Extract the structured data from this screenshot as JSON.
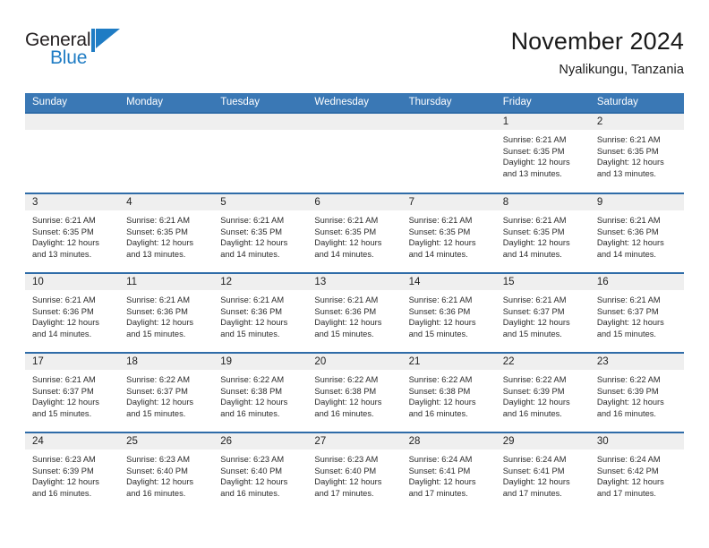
{
  "brand": {
    "name_part1": "General",
    "name_part2": "Blue",
    "mark_icon": "triangle-flag-icon",
    "mark_color": "#1f7cc4"
  },
  "header": {
    "title": "November 2024",
    "subtitle": "Nyalikungu, Tanzania"
  },
  "theme": {
    "header_blue": "#3a78b5",
    "row_border_blue": "#2f6ca8",
    "day_strip_gray": "#efefef",
    "brand_blue": "#1f7cc4"
  },
  "calendar": {
    "weekday_headers": [
      "Sunday",
      "Monday",
      "Tuesday",
      "Wednesday",
      "Thursday",
      "Friday",
      "Saturday"
    ],
    "weeks": [
      [
        {
          "day": "",
          "lines": []
        },
        {
          "day": "",
          "lines": []
        },
        {
          "day": "",
          "lines": []
        },
        {
          "day": "",
          "lines": []
        },
        {
          "day": "",
          "lines": []
        },
        {
          "day": "1",
          "lines": [
            "Sunrise: 6:21 AM",
            "Sunset: 6:35 PM",
            "Daylight: 12 hours",
            "and 13 minutes."
          ]
        },
        {
          "day": "2",
          "lines": [
            "Sunrise: 6:21 AM",
            "Sunset: 6:35 PM",
            "Daylight: 12 hours",
            "and 13 minutes."
          ]
        }
      ],
      [
        {
          "day": "3",
          "lines": [
            "Sunrise: 6:21 AM",
            "Sunset: 6:35 PM",
            "Daylight: 12 hours",
            "and 13 minutes."
          ]
        },
        {
          "day": "4",
          "lines": [
            "Sunrise: 6:21 AM",
            "Sunset: 6:35 PM",
            "Daylight: 12 hours",
            "and 13 minutes."
          ]
        },
        {
          "day": "5",
          "lines": [
            "Sunrise: 6:21 AM",
            "Sunset: 6:35 PM",
            "Daylight: 12 hours",
            "and 14 minutes."
          ]
        },
        {
          "day": "6",
          "lines": [
            "Sunrise: 6:21 AM",
            "Sunset: 6:35 PM",
            "Daylight: 12 hours",
            "and 14 minutes."
          ]
        },
        {
          "day": "7",
          "lines": [
            "Sunrise: 6:21 AM",
            "Sunset: 6:35 PM",
            "Daylight: 12 hours",
            "and 14 minutes."
          ]
        },
        {
          "day": "8",
          "lines": [
            "Sunrise: 6:21 AM",
            "Sunset: 6:35 PM",
            "Daylight: 12 hours",
            "and 14 minutes."
          ]
        },
        {
          "day": "9",
          "lines": [
            "Sunrise: 6:21 AM",
            "Sunset: 6:36 PM",
            "Daylight: 12 hours",
            "and 14 minutes."
          ]
        }
      ],
      [
        {
          "day": "10",
          "lines": [
            "Sunrise: 6:21 AM",
            "Sunset: 6:36 PM",
            "Daylight: 12 hours",
            "and 14 minutes."
          ]
        },
        {
          "day": "11",
          "lines": [
            "Sunrise: 6:21 AM",
            "Sunset: 6:36 PM",
            "Daylight: 12 hours",
            "and 15 minutes."
          ]
        },
        {
          "day": "12",
          "lines": [
            "Sunrise: 6:21 AM",
            "Sunset: 6:36 PM",
            "Daylight: 12 hours",
            "and 15 minutes."
          ]
        },
        {
          "day": "13",
          "lines": [
            "Sunrise: 6:21 AM",
            "Sunset: 6:36 PM",
            "Daylight: 12 hours",
            "and 15 minutes."
          ]
        },
        {
          "day": "14",
          "lines": [
            "Sunrise: 6:21 AM",
            "Sunset: 6:36 PM",
            "Daylight: 12 hours",
            "and 15 minutes."
          ]
        },
        {
          "day": "15",
          "lines": [
            "Sunrise: 6:21 AM",
            "Sunset: 6:37 PM",
            "Daylight: 12 hours",
            "and 15 minutes."
          ]
        },
        {
          "day": "16",
          "lines": [
            "Sunrise: 6:21 AM",
            "Sunset: 6:37 PM",
            "Daylight: 12 hours",
            "and 15 minutes."
          ]
        }
      ],
      [
        {
          "day": "17",
          "lines": [
            "Sunrise: 6:21 AM",
            "Sunset: 6:37 PM",
            "Daylight: 12 hours",
            "and 15 minutes."
          ]
        },
        {
          "day": "18",
          "lines": [
            "Sunrise: 6:22 AM",
            "Sunset: 6:37 PM",
            "Daylight: 12 hours",
            "and 15 minutes."
          ]
        },
        {
          "day": "19",
          "lines": [
            "Sunrise: 6:22 AM",
            "Sunset: 6:38 PM",
            "Daylight: 12 hours",
            "and 16 minutes."
          ]
        },
        {
          "day": "20",
          "lines": [
            "Sunrise: 6:22 AM",
            "Sunset: 6:38 PM",
            "Daylight: 12 hours",
            "and 16 minutes."
          ]
        },
        {
          "day": "21",
          "lines": [
            "Sunrise: 6:22 AM",
            "Sunset: 6:38 PM",
            "Daylight: 12 hours",
            "and 16 minutes."
          ]
        },
        {
          "day": "22",
          "lines": [
            "Sunrise: 6:22 AM",
            "Sunset: 6:39 PM",
            "Daylight: 12 hours",
            "and 16 minutes."
          ]
        },
        {
          "day": "23",
          "lines": [
            "Sunrise: 6:22 AM",
            "Sunset: 6:39 PM",
            "Daylight: 12 hours",
            "and 16 minutes."
          ]
        }
      ],
      [
        {
          "day": "24",
          "lines": [
            "Sunrise: 6:23 AM",
            "Sunset: 6:39 PM",
            "Daylight: 12 hours",
            "and 16 minutes."
          ]
        },
        {
          "day": "25",
          "lines": [
            "Sunrise: 6:23 AM",
            "Sunset: 6:40 PM",
            "Daylight: 12 hours",
            "and 16 minutes."
          ]
        },
        {
          "day": "26",
          "lines": [
            "Sunrise: 6:23 AM",
            "Sunset: 6:40 PM",
            "Daylight: 12 hours",
            "and 16 minutes."
          ]
        },
        {
          "day": "27",
          "lines": [
            "Sunrise: 6:23 AM",
            "Sunset: 6:40 PM",
            "Daylight: 12 hours",
            "and 17 minutes."
          ]
        },
        {
          "day": "28",
          "lines": [
            "Sunrise: 6:24 AM",
            "Sunset: 6:41 PM",
            "Daylight: 12 hours",
            "and 17 minutes."
          ]
        },
        {
          "day": "29",
          "lines": [
            "Sunrise: 6:24 AM",
            "Sunset: 6:41 PM",
            "Daylight: 12 hours",
            "and 17 minutes."
          ]
        },
        {
          "day": "30",
          "lines": [
            "Sunrise: 6:24 AM",
            "Sunset: 6:42 PM",
            "Daylight: 12 hours",
            "and 17 minutes."
          ]
        }
      ]
    ]
  }
}
